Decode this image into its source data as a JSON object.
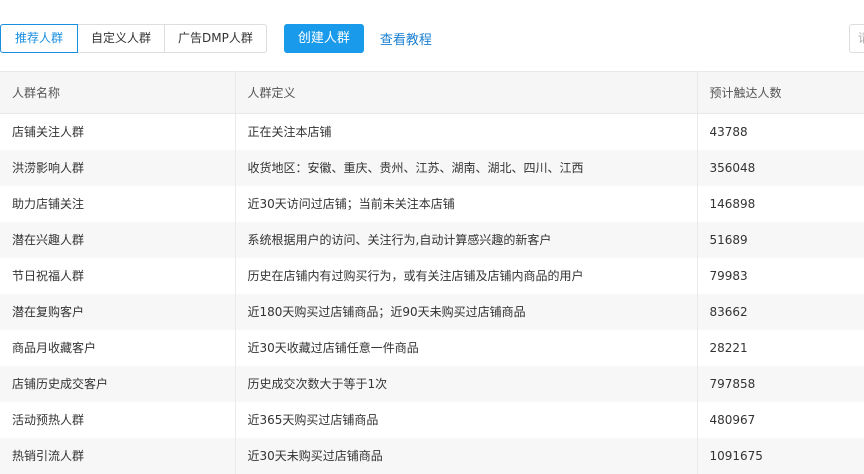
{
  "tabs": [
    "推荐人群",
    "自定义人群",
    "广告DMP人群"
  ],
  "create_label": "创建人群",
  "tutorial_label": "查看教程",
  "search_placeholder": "请",
  "columns": [
    "人群名称",
    "人群定义",
    "预计触达人数"
  ],
  "rows": [
    [
      "店铺关注人群",
      "正在关注本店铺",
      "43788"
    ],
    [
      "洪涝影响人群",
      "收货地区：安徽、重庆、贵州、江苏、湖南、湖北、四川、江西",
      "356048"
    ],
    [
      "助力店铺关注",
      "近30天访问过店铺；当前未关注本店铺",
      "146898"
    ],
    [
      "潜在兴趣人群",
      "系统根据用户的访问、关注行为,自动计算感兴趣的新客户",
      "51689"
    ],
    [
      "节日祝福人群",
      "历史在店铺内有过购买行为，或有关注店铺及店铺内商品的用户",
      "79983"
    ],
    [
      "潜在复购客户",
      "近180天购买过店铺商品；近90天未购买过店铺商品",
      "83662"
    ],
    [
      "商品月收藏客户",
      "近30天收藏过店铺任意一件商品",
      "28221"
    ],
    [
      "店铺历史成交客户",
      "历史成交次数大于等于1次",
      "797858"
    ],
    [
      "活动预热人群",
      "近365天购买过店铺商品",
      "480967"
    ],
    [
      "热销引流人群",
      "近30天未购买过店铺商品",
      "1091675"
    ]
  ]
}
